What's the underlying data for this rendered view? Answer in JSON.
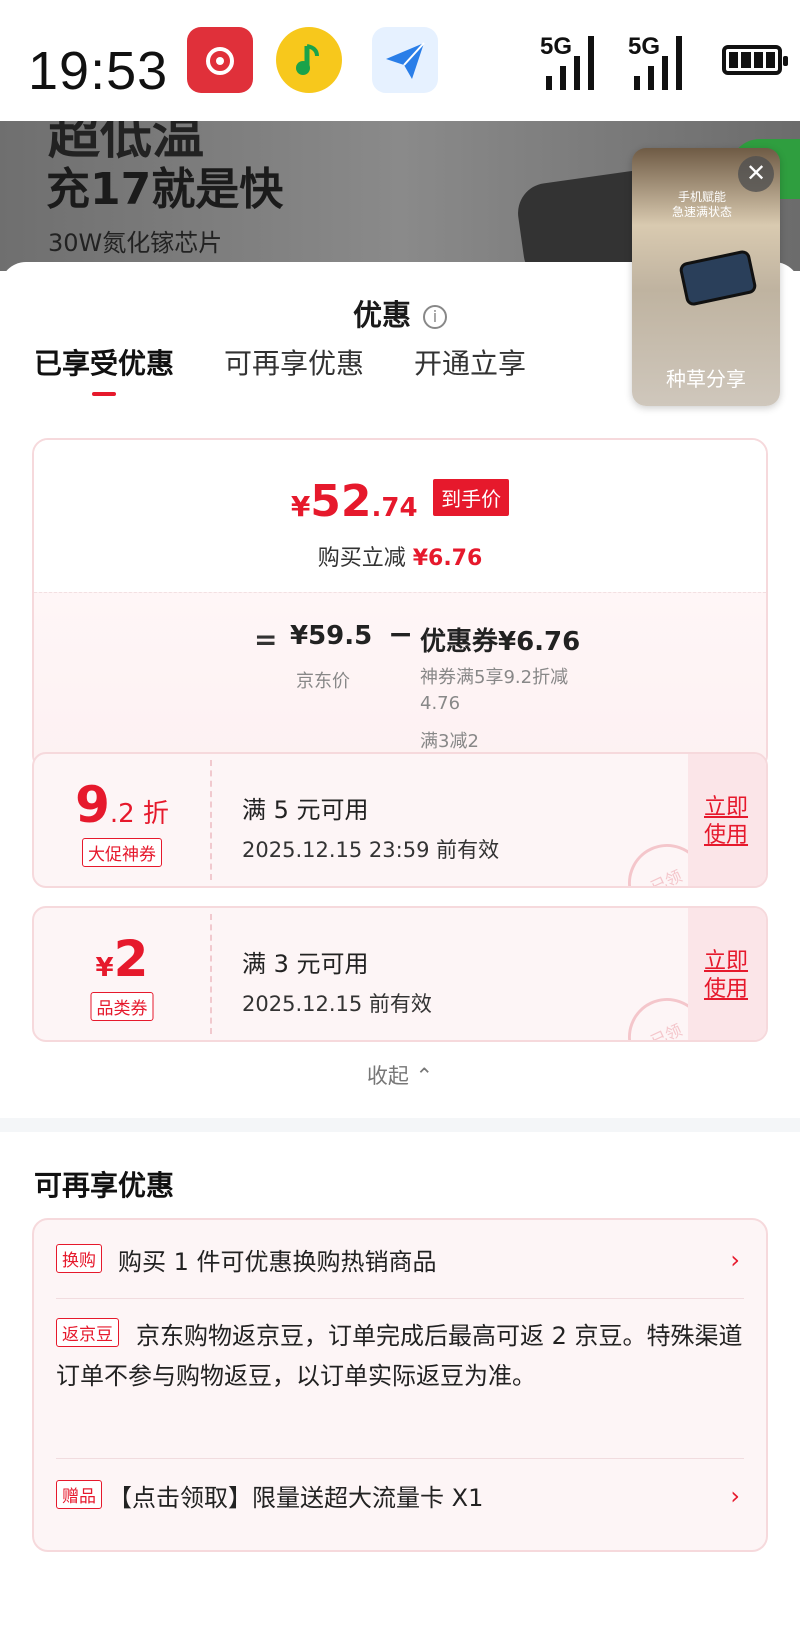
{
  "status": {
    "time": "19:53",
    "network1": "5G",
    "network2": "5G"
  },
  "banner": {
    "tag": "超低温",
    "title": "充17就是快",
    "subtitle": "30W氮化镓芯片"
  },
  "video": {
    "caption": "手机赋能 急速满状态",
    "label": "种草分享",
    "close": "✕"
  },
  "sheet": {
    "title": "优惠",
    "tabs": [
      "已享受优惠",
      "可再享优惠",
      "开通立享"
    ]
  },
  "price": {
    "yen": "¥",
    "main": "52",
    "decimal": ".74",
    "badge": "到手价",
    "reduce_label": "购买立减",
    "reduce_value": "¥6.76",
    "eq": "=",
    "jd_price": "¥59.5",
    "jd_label": "京东价",
    "minus": "−",
    "coupon_total": "优惠券¥6.76",
    "coupon_detail1": "神券满5享9.2折减4.76",
    "coupon_detail2": "满3减2"
  },
  "coupons": [
    {
      "value_main": "9",
      "value_sub": ".2 折",
      "tag": "大促神券",
      "condition": "满 5 元可用",
      "expire": "2025.12.15 23:59 前有效",
      "action": "立即使用",
      "stamp": "已领"
    },
    {
      "value_prefix": "¥",
      "value_main": "2",
      "tag": "品类券",
      "condition": "满 3 元可用",
      "expire": "2025.12.15 前有效",
      "action": "立即使用",
      "stamp": "已领"
    }
  ],
  "collapse": "收起 ⌃",
  "more": {
    "title": "可再享优惠",
    "items": [
      {
        "tag": "换购",
        "text": "购买 1 件可优惠换购热销商品",
        "arrow": "›"
      },
      {
        "tag": "返京豆",
        "text": "京东购物返京豆，订单完成后最高可返 2 京豆。特殊渠道订单不参与购物返豆，以订单实际返豆为准。"
      },
      {
        "tag": "赠品",
        "text": "【点击领取】限量送超大流量卡 X1",
        "arrow": "›"
      }
    ]
  },
  "colors": {
    "accent": "#e6192c",
    "card_border": "#f6d9dc",
    "card_bg": "#fdf5f6"
  }
}
